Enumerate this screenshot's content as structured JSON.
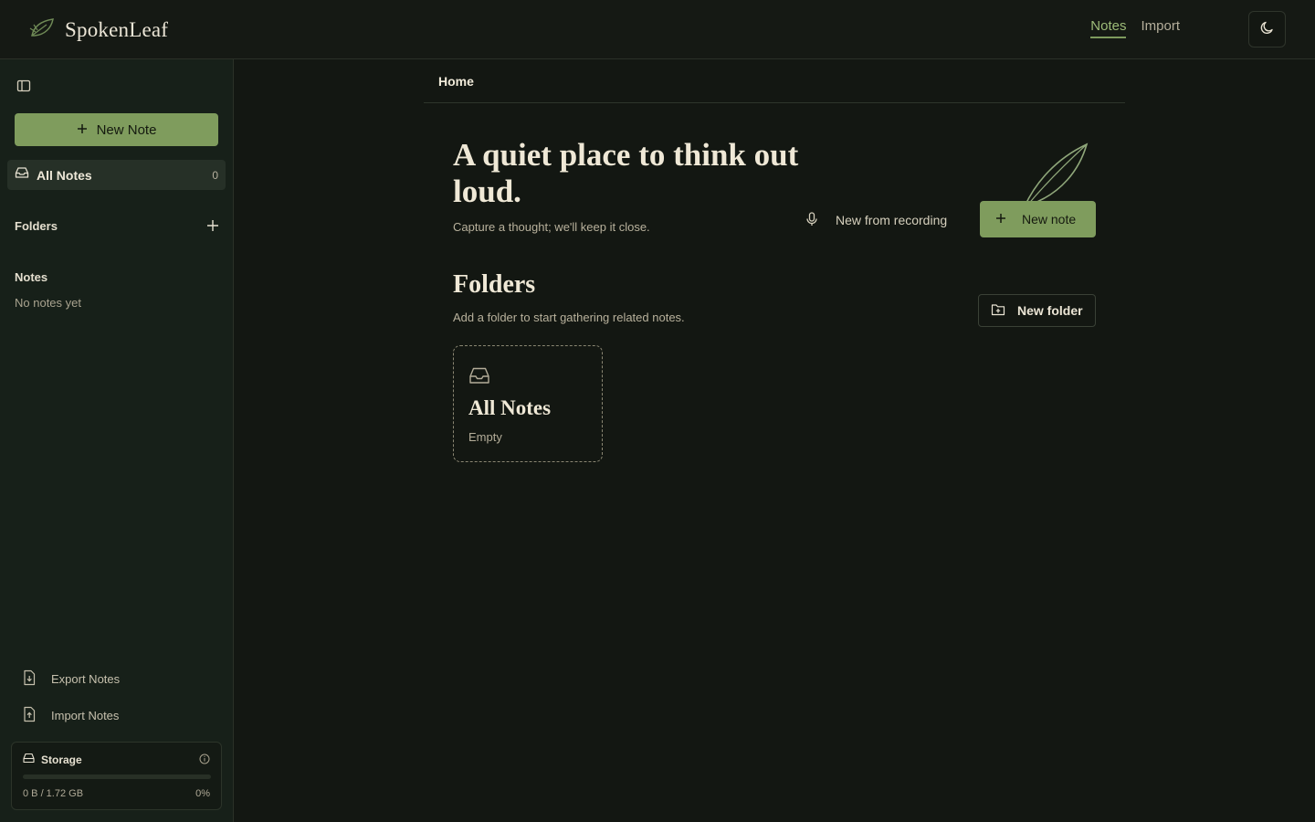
{
  "app": {
    "name": "SpokenLeaf",
    "logo_icon": "leaf-icon"
  },
  "top_nav": {
    "items": [
      {
        "label": "Notes",
        "active": true
      },
      {
        "label": "Import",
        "active": false
      }
    ],
    "theme_toggle_icon": "moon-icon"
  },
  "sidebar": {
    "toggle_icon": "sidebar-panel-icon",
    "new_note_label": "New Note",
    "all_notes": {
      "label": "All Notes",
      "count": "0",
      "icon": "inbox-icon"
    },
    "folders_label": "Folders",
    "notes_label": "Notes",
    "no_notes_label": "No notes yet",
    "export_label": "Export Notes",
    "import_label": "Import Notes",
    "storage": {
      "title": "Storage",
      "used_text": "0 B / 1.72 GB",
      "percent_text": "0%",
      "percent_value": 0
    }
  },
  "main": {
    "breadcrumb": "Home",
    "hero_title": "A quiet place to think out loud.",
    "hero_subtitle": "Capture a thought; we'll keep it close.",
    "record_button_label": "New from recording",
    "new_note_label": "New note",
    "folders_title": "Folders",
    "folders_subtitle": "Add a folder to start gathering related notes.",
    "new_folder_label": "New folder",
    "folder_cards": [
      {
        "name": "All Notes",
        "status": "Empty"
      }
    ]
  },
  "colors": {
    "accent": "#7f9c5d",
    "background": "#131712",
    "sidebar": "#172019",
    "text": "#efe8d6"
  }
}
